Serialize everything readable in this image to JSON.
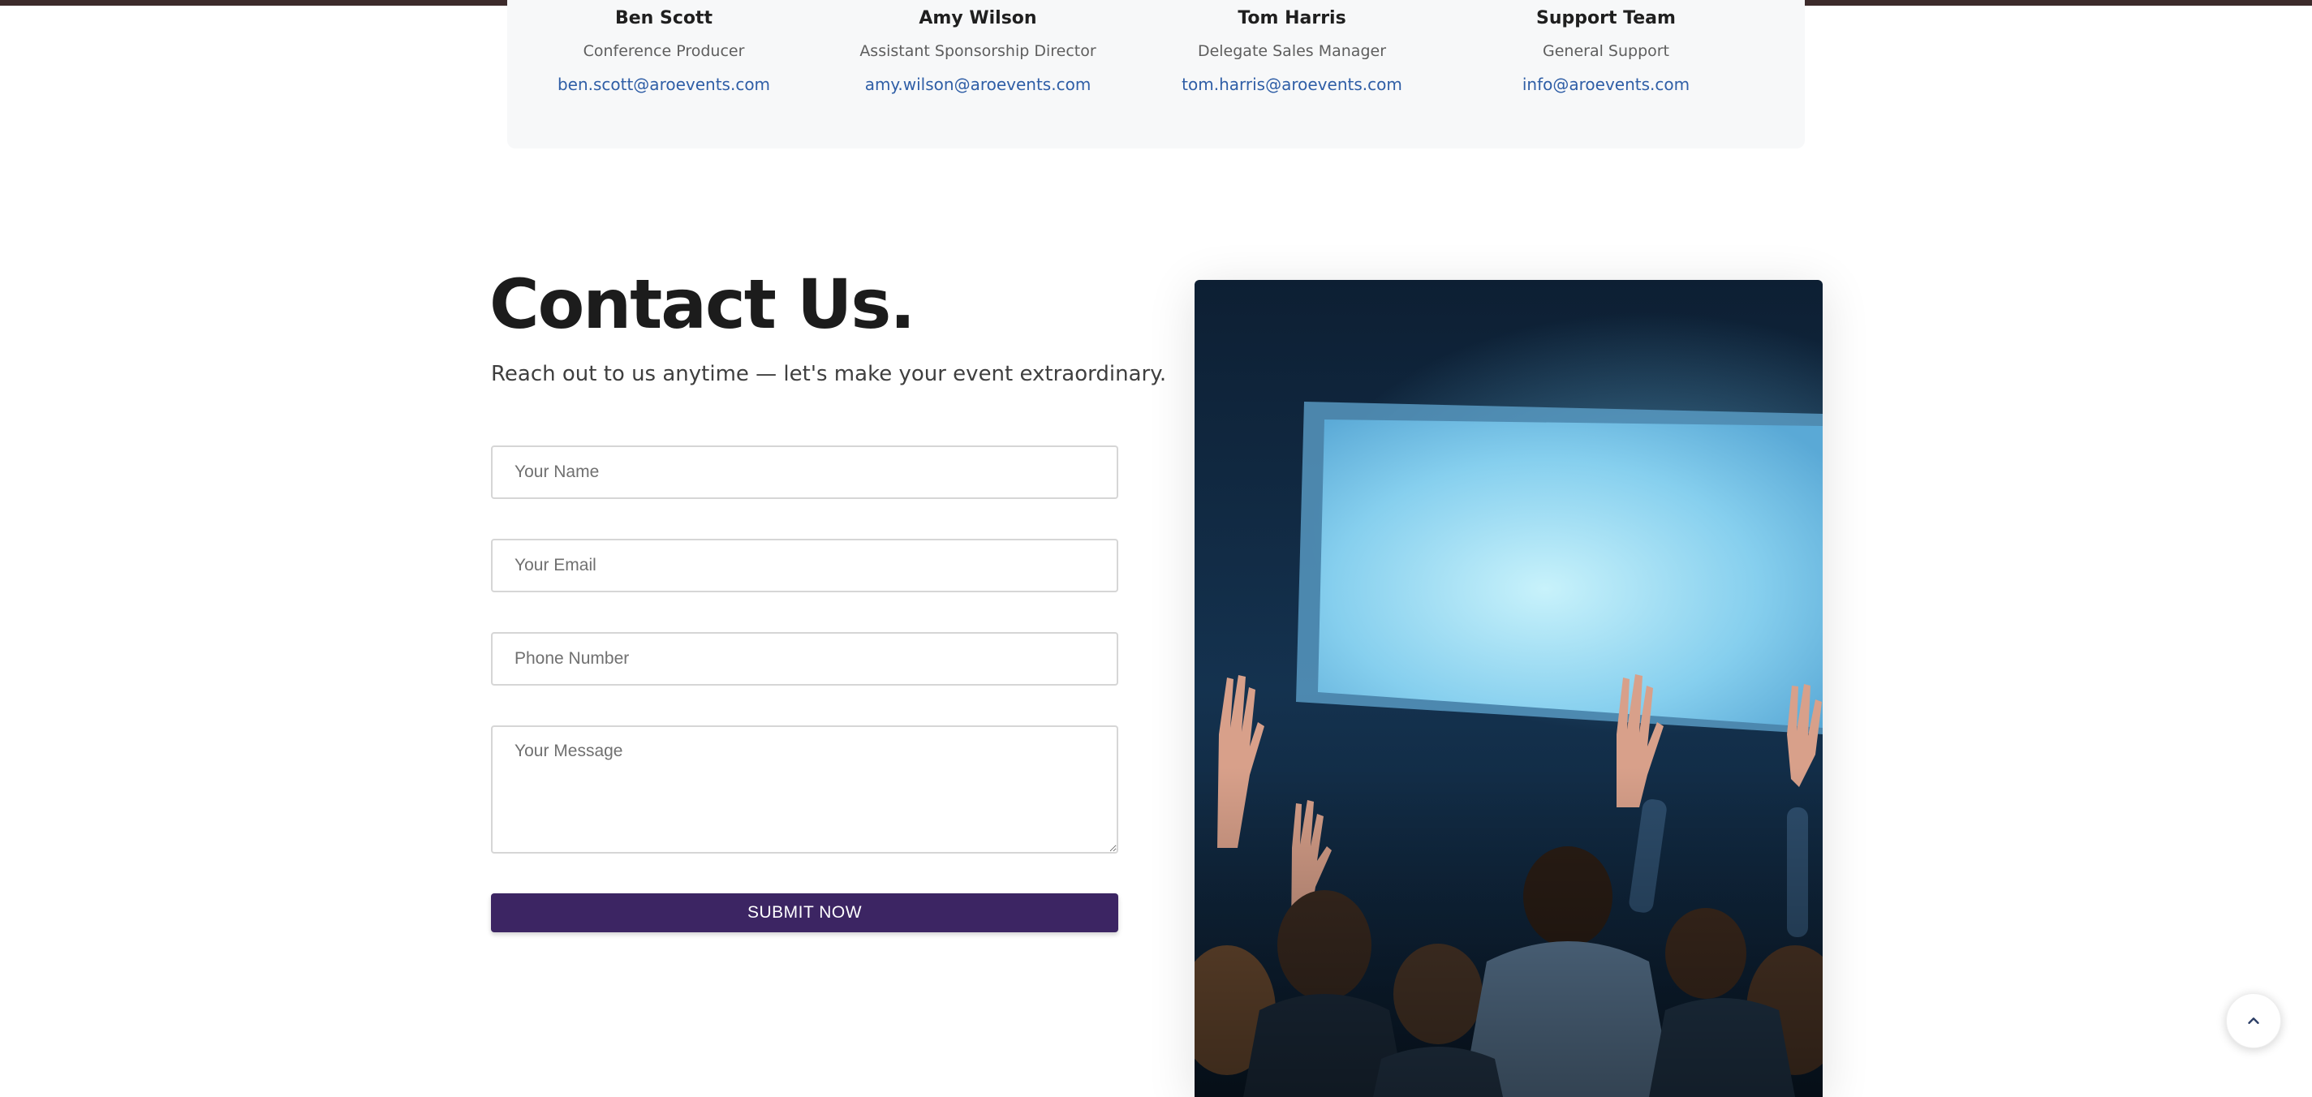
{
  "team": [
    {
      "name": "Ben Scott",
      "role": "Conference Producer",
      "email": "ben.scott@aroevents.com"
    },
    {
      "name": "Amy Wilson",
      "role": "Assistant Sponsorship Director",
      "email": "amy.wilson@aroevents.com"
    },
    {
      "name": "Tom Harris",
      "role": "Delegate Sales Manager",
      "email": "tom.harris@aroevents.com"
    },
    {
      "name": "Support Team",
      "role": "General Support",
      "email": "info@aroevents.com"
    }
  ],
  "contact": {
    "heading": "Contact Us.",
    "subtitle": "Reach out to us anytime — let's make your event extraordinary.",
    "form": {
      "name_placeholder": "Your Name",
      "email_placeholder": "Your Email",
      "phone_placeholder": "Phone Number",
      "message_placeholder": "Your Message",
      "submit_label": "SUBMIT NOW"
    }
  },
  "colors": {
    "accent": "#3c2563",
    "link": "#2f5ea6",
    "top_bar": "#3d2b2b"
  },
  "icons": {
    "back_to_top": "chevron-up-icon"
  }
}
